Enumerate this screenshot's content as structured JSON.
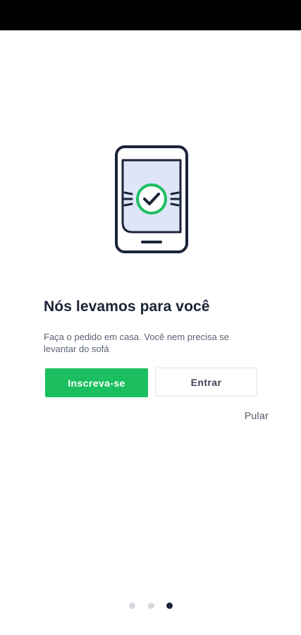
{
  "onboarding": {
    "title": "Nós levamos para você",
    "subtitle": "Faça o pedido em casa. Você nem precisa se levantar do sofá",
    "signup_label": "Inscreva-se",
    "login_label": "Entrar",
    "skip_label": "Pular"
  },
  "pager": {
    "total": 3,
    "current": 3
  },
  "colors": {
    "primary_green": "#1bbf5f",
    "dark_navy": "#1b2338",
    "phone_fill": "#dde5f7",
    "dot_inactive": "#d6d8de"
  },
  "icons": {
    "illustration": "phone-check-icon"
  }
}
